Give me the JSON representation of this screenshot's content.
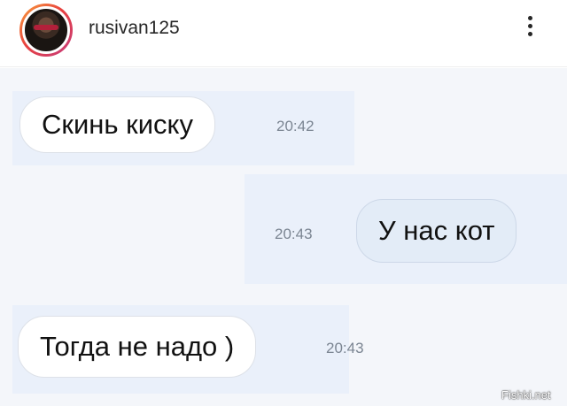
{
  "header": {
    "username": "rusivan125",
    "avatar_icon": "user-avatar",
    "more_icon": "more-vertical-icon"
  },
  "messages": [
    {
      "text": "Скинь киску",
      "time": "20:42",
      "direction": "incoming"
    },
    {
      "text": "У нас кот",
      "time": "20:43",
      "direction": "outgoing"
    },
    {
      "text": "Тогда не надо )",
      "time": "20:43",
      "direction": "incoming"
    }
  ],
  "watermark": "Fishki.net",
  "colors": {
    "chat_background": "#f4f6fa",
    "incoming_bubble": "#ffffff",
    "outgoing_bubble": "#e3ecf7",
    "timestamp": "#7b8592"
  }
}
